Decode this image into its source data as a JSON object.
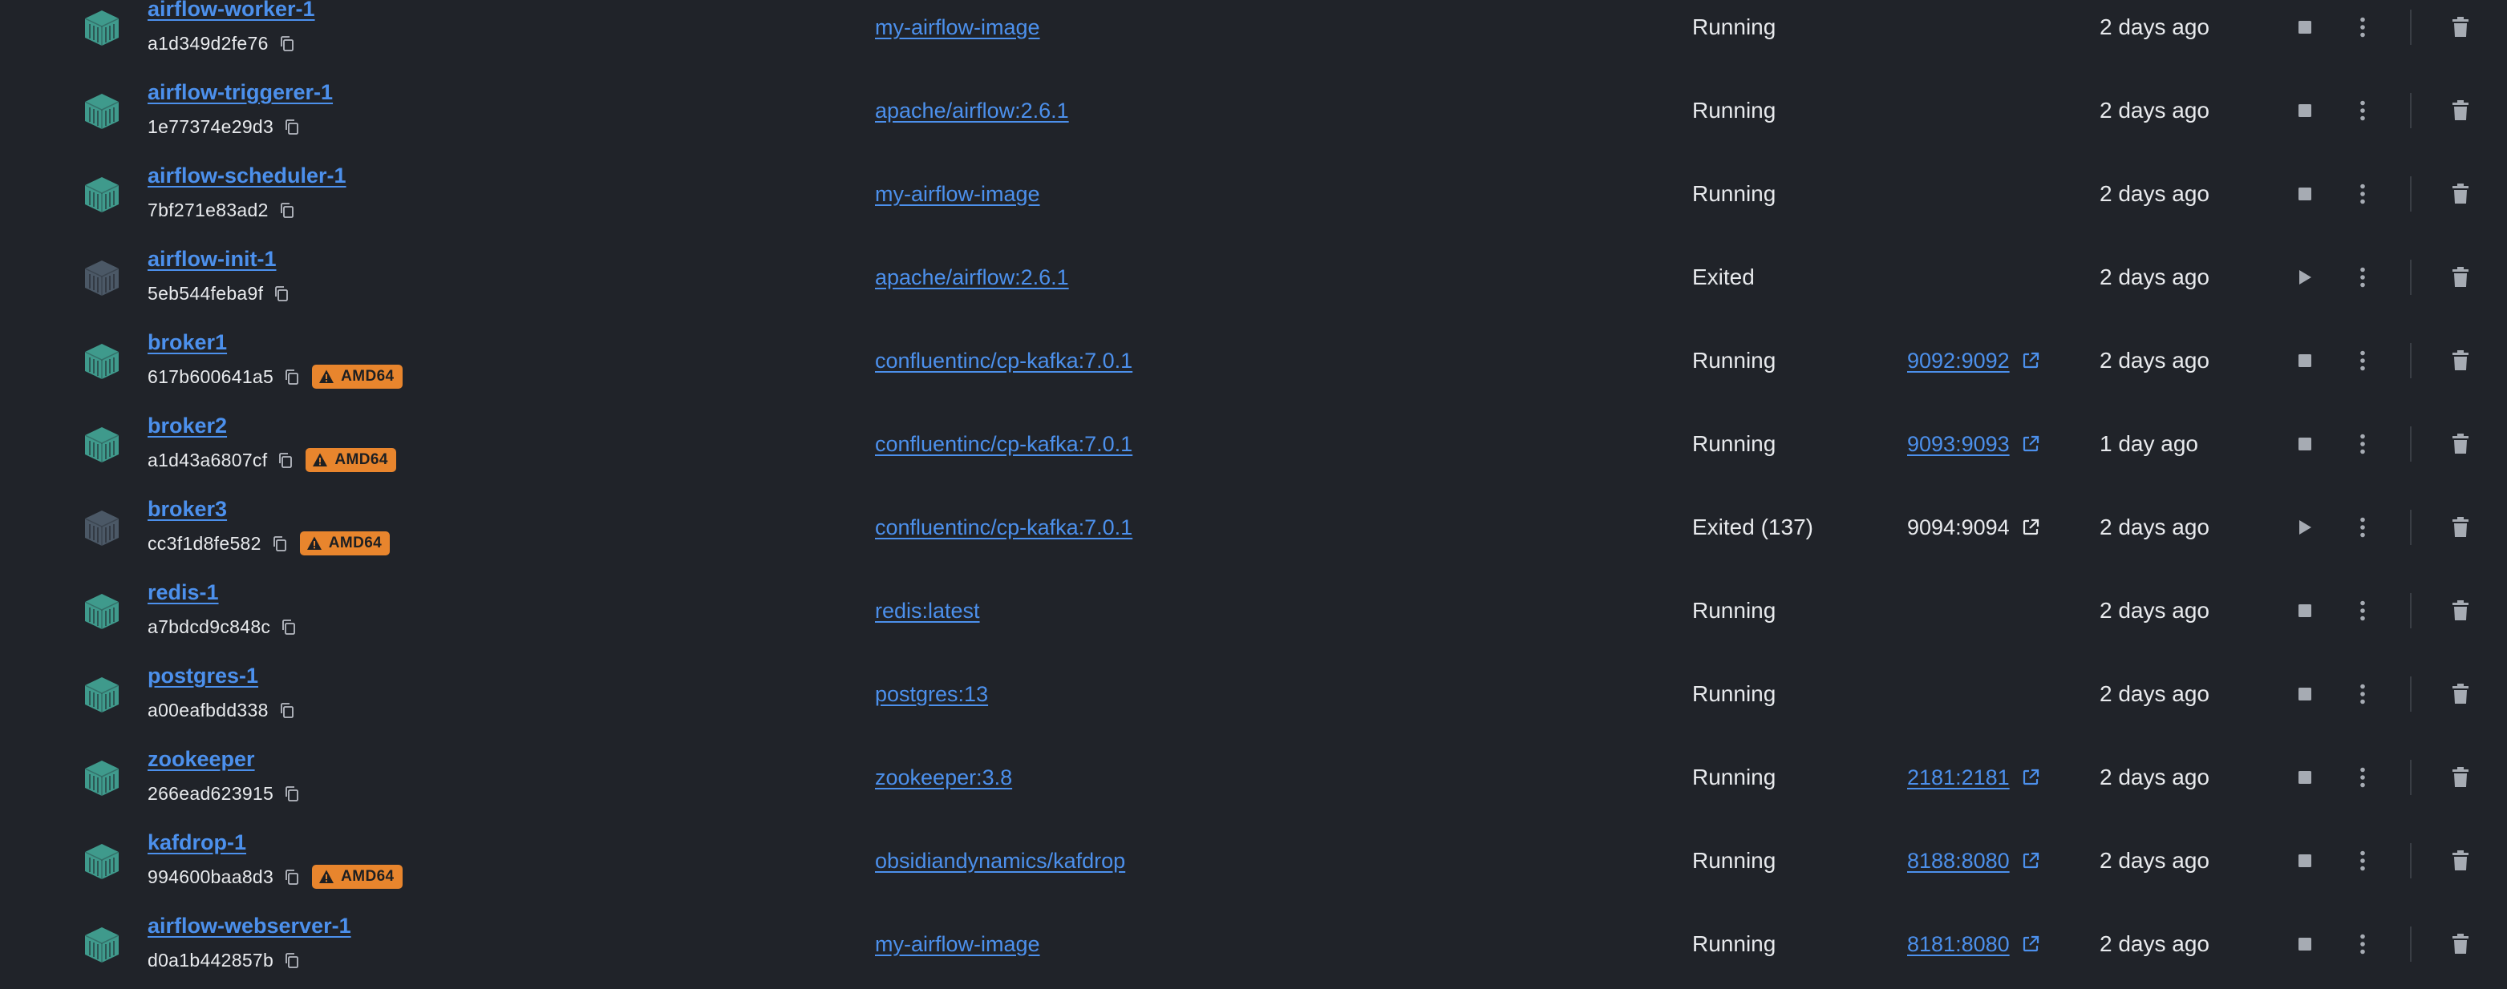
{
  "colors": {
    "background": "#202329",
    "link": "#4c90ec",
    "text": "#e8eaed",
    "running_icon": "#3f9a8c",
    "exited_icon": "#4b5866",
    "badge": "#e8852d"
  },
  "containers": [
    {
      "name": "airflow-worker-1",
      "id": "a1d349d2fe76",
      "badge": "",
      "image": "my-airflow-image",
      "status": "Running",
      "state": "running",
      "port": "",
      "port_active": false,
      "started": "2 days ago"
    },
    {
      "name": "airflow-triggerer-1",
      "id": "1e77374e29d3",
      "badge": "",
      "image": "apache/airflow:2.6.1",
      "status": "Running",
      "state": "running",
      "port": "",
      "port_active": false,
      "started": "2 days ago"
    },
    {
      "name": "airflow-scheduler-1",
      "id": "7bf271e83ad2",
      "badge": "",
      "image": "my-airflow-image",
      "status": "Running",
      "state": "running",
      "port": "",
      "port_active": false,
      "started": "2 days ago"
    },
    {
      "name": "airflow-init-1",
      "id": "5eb544feba9f",
      "badge": "",
      "image": "apache/airflow:2.6.1",
      "status": "Exited",
      "state": "exited",
      "port": "",
      "port_active": false,
      "started": "2 days ago"
    },
    {
      "name": "broker1",
      "id": "617b600641a5",
      "badge": "AMD64",
      "image": "confluentinc/cp-kafka:7.0.1",
      "status": "Running",
      "state": "running",
      "port": "9092:9092",
      "port_active": true,
      "started": "2 days ago"
    },
    {
      "name": "broker2",
      "id": "a1d43a6807cf",
      "badge": "AMD64",
      "image": "confluentinc/cp-kafka:7.0.1",
      "status": "Running",
      "state": "running",
      "port": "9093:9093",
      "port_active": true,
      "started": "1 day ago"
    },
    {
      "name": "broker3",
      "id": "cc3f1d8fe582",
      "badge": "AMD64",
      "image": "confluentinc/cp-kafka:7.0.1",
      "status": "Exited (137)",
      "state": "exited",
      "port": "9094:9094",
      "port_active": false,
      "started": "2 days ago"
    },
    {
      "name": "redis-1",
      "id": "a7bdcd9c848c",
      "badge": "",
      "image": "redis:latest",
      "status": "Running",
      "state": "running",
      "port": "",
      "port_active": false,
      "started": "2 days ago"
    },
    {
      "name": "postgres-1",
      "id": "a00eafbdd338",
      "badge": "",
      "image": "postgres:13",
      "status": "Running",
      "state": "running",
      "port": "",
      "port_active": false,
      "started": "2 days ago"
    },
    {
      "name": "zookeeper",
      "id": "266ead623915",
      "badge": "",
      "image": "zookeeper:3.8",
      "status": "Running",
      "state": "running",
      "port": "2181:2181",
      "port_active": true,
      "started": "2 days ago"
    },
    {
      "name": "kafdrop-1",
      "id": "994600baa8d3",
      "badge": "AMD64",
      "image": "obsidiandynamics/kafdrop",
      "status": "Running",
      "state": "running",
      "port": "8188:8080",
      "port_active": true,
      "started": "2 days ago"
    },
    {
      "name": "airflow-webserver-1",
      "id": "d0a1b442857b",
      "badge": "",
      "image": "my-airflow-image",
      "status": "Running",
      "state": "running",
      "port": "8181:8080",
      "port_active": true,
      "started": "2 days ago"
    }
  ]
}
